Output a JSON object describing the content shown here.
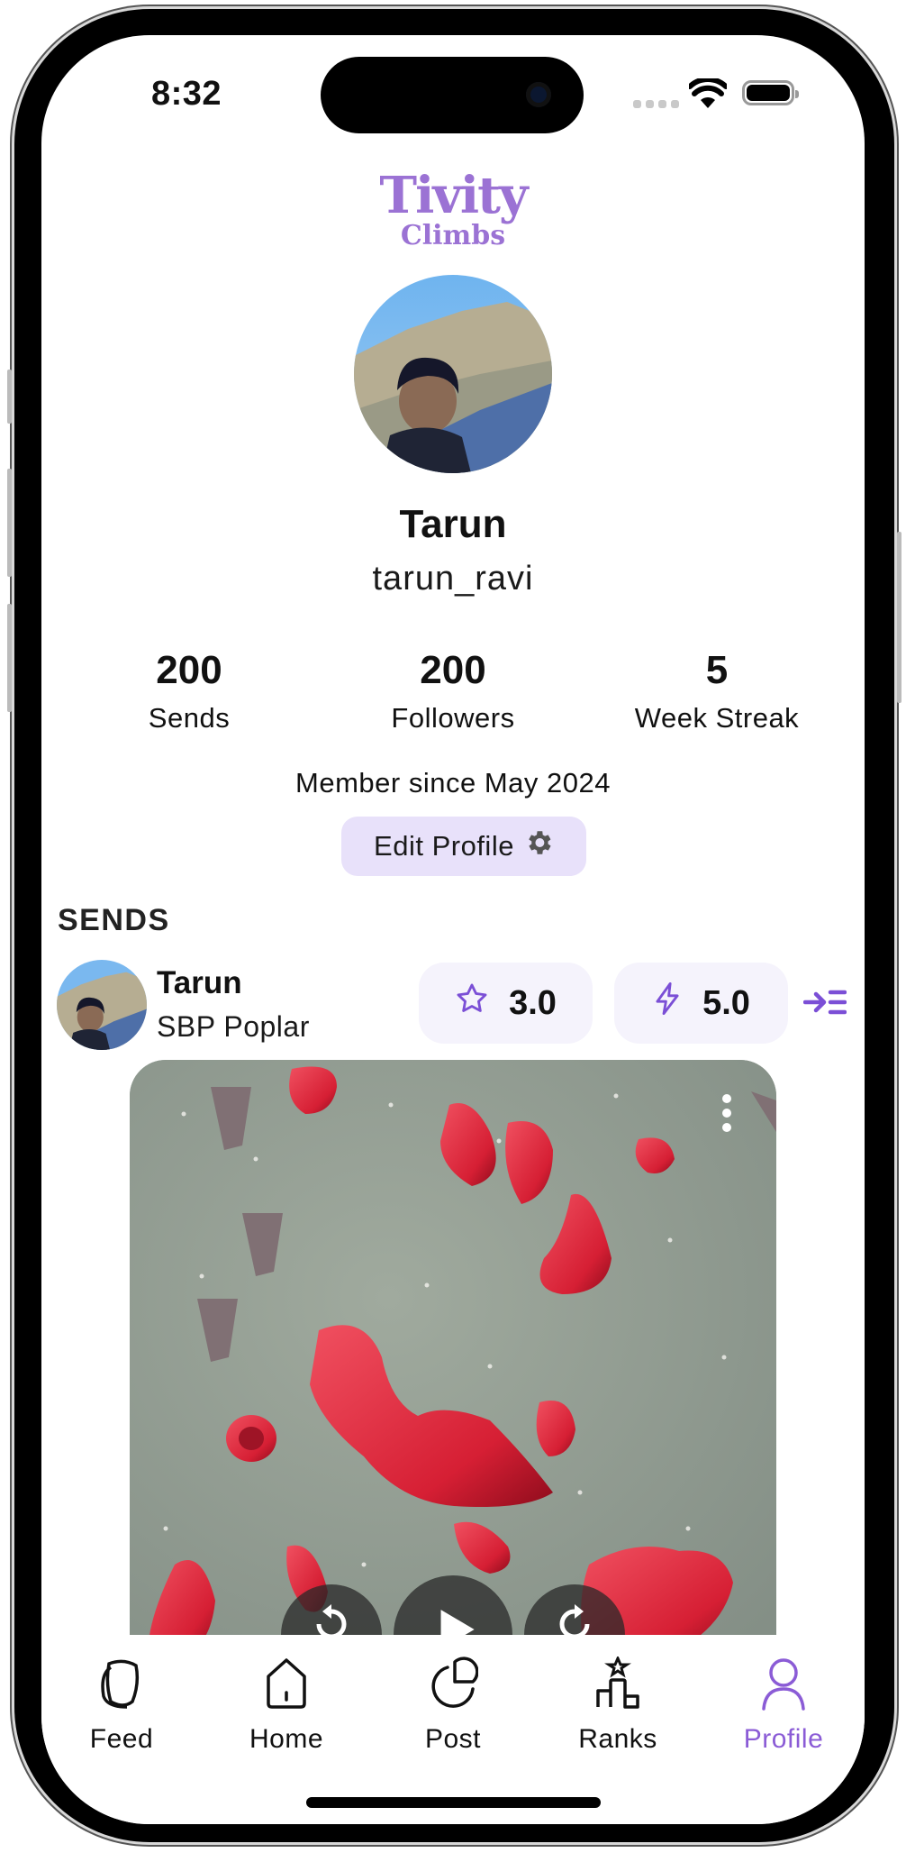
{
  "status_bar": {
    "time": "8:32"
  },
  "header": {
    "logo_line1": "Tivity",
    "logo_line2": "Climbs"
  },
  "profile": {
    "name": "Tarun",
    "username": "tarun_ravi",
    "stats": [
      {
        "value": "200",
        "label": "Sends"
      },
      {
        "value": "200",
        "label": "Followers"
      },
      {
        "value": "5",
        "label": "Week Streak"
      }
    ],
    "member_since": "Member since May 2024",
    "edit_button_label": "Edit Profile"
  },
  "sends": {
    "section_title": "SENDS",
    "items": [
      {
        "user": "Tarun",
        "gym": "SBP Poplar",
        "quality_rating": "3.0",
        "difficulty_rating": "5.0"
      }
    ]
  },
  "nav": {
    "items": [
      {
        "label": "Feed",
        "icon": "feed-icon",
        "active": false
      },
      {
        "label": "Home",
        "icon": "home-icon",
        "active": false
      },
      {
        "label": "Post",
        "icon": "post-icon",
        "active": false
      },
      {
        "label": "Ranks",
        "icon": "ranks-podium-icon",
        "active": false
      },
      {
        "label": "Profile",
        "icon": "profile-user-icon",
        "active": true
      }
    ]
  },
  "colors": {
    "accent": "#8b5cd6",
    "logo": "#9b72d4",
    "edit_button_bg": "#e8e1fa",
    "pill_bg": "#f5f3fc"
  }
}
